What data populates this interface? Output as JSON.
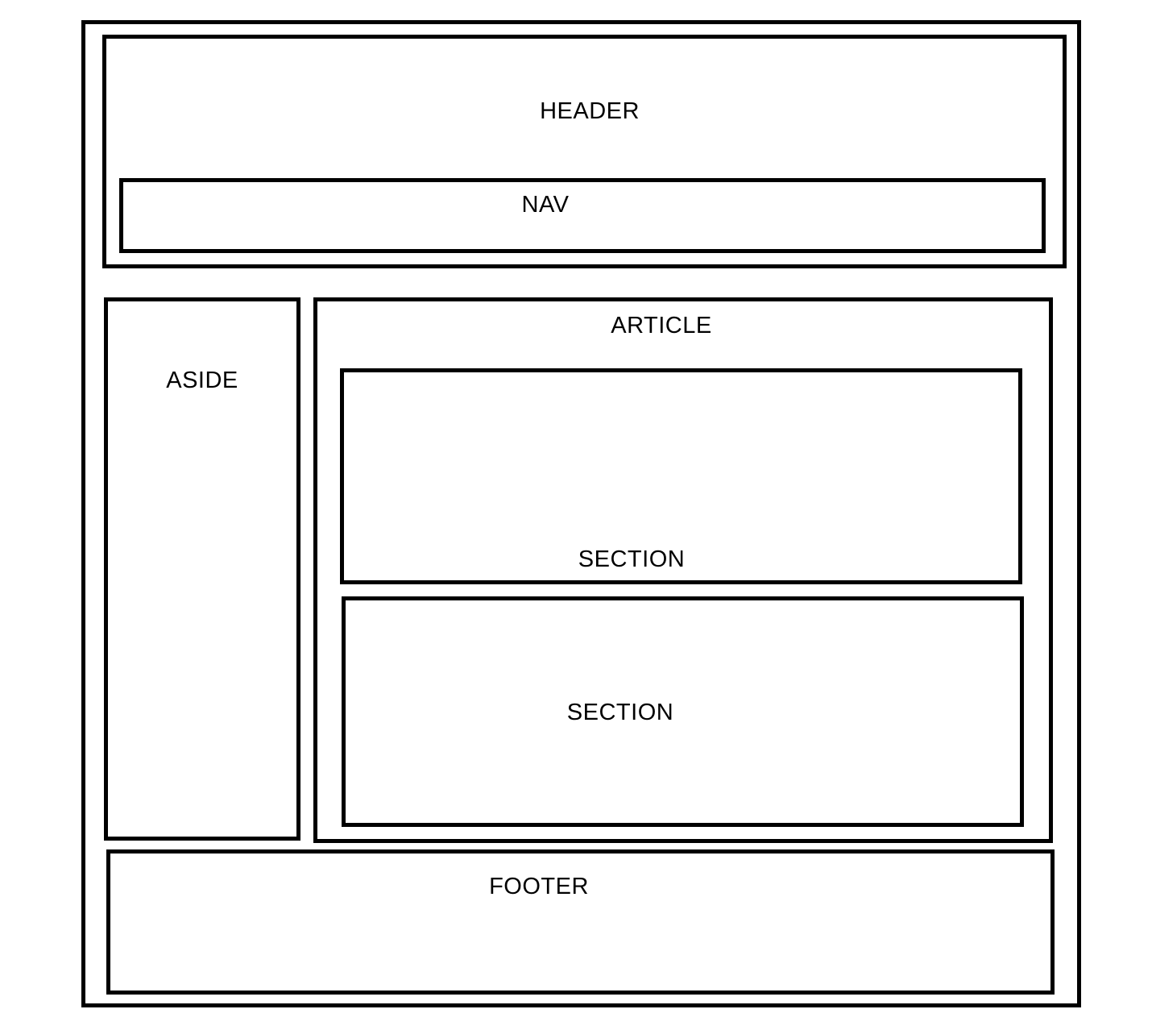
{
  "diagram": {
    "header": {
      "label": "HEADER"
    },
    "nav": {
      "label": "NAV"
    },
    "aside": {
      "label": "ASIDE"
    },
    "article": {
      "label": "ARTICLE"
    },
    "sections": [
      {
        "label": "SECTION"
      },
      {
        "label": "SECTION"
      }
    ],
    "footer": {
      "label": "FOOTER"
    },
    "colors": {
      "stroke": "#000000",
      "background": "#ffffff"
    }
  }
}
